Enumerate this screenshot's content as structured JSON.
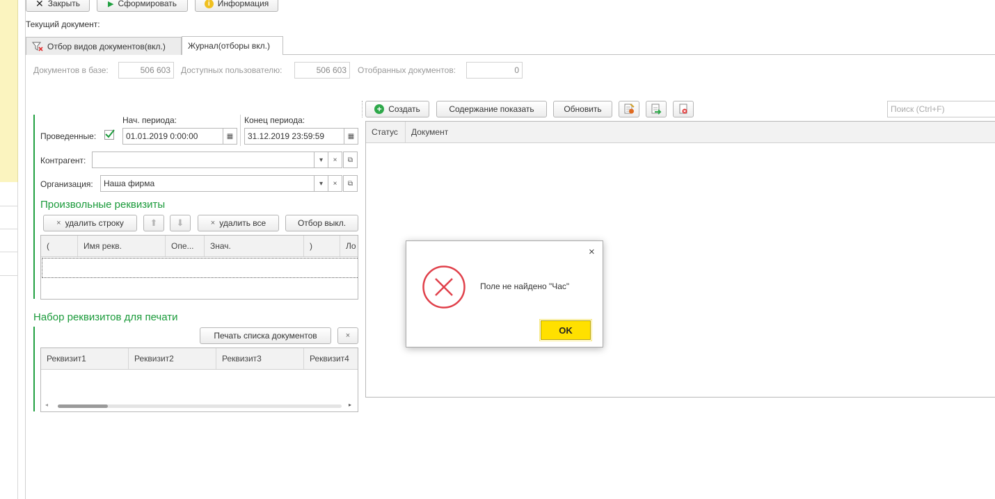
{
  "toolbar": {
    "close_label": "Закрыть",
    "generate_label": "Сформировать",
    "info_label": "Информация"
  },
  "current_document_label": "Текущий документ:",
  "tabs": [
    {
      "label": "Отбор видов документов(вкл.)",
      "icon": "filter-off-icon"
    },
    {
      "label": "Журнал(отборы вкл.)"
    }
  ],
  "stats": {
    "in_base_label": "Документов в базе:",
    "in_base_value": "506 603",
    "available_label": "Доступных пользователю:",
    "available_value": "506 603",
    "selected_label": "Отобранных документов:",
    "selected_value": "0"
  },
  "filters": {
    "period_start_label": "Нач. периода:",
    "period_end_label": "Конец периода:",
    "posted_label": "Проведенные:",
    "posted_checked": true,
    "period_start_value": "01.01.2019  0:00:00",
    "period_end_value": "31.12.2019 23:59:59",
    "counterparty_label": "Контрагент:",
    "counterparty_value": "",
    "organization_label": "Организация:",
    "organization_value": "Наша фирма"
  },
  "custom_attrs": {
    "title": "Произвольные  реквизиты",
    "delete_row_label": "удалить строку",
    "delete_all_label": "удалить все",
    "filter_off_label": "Отбор выкл.",
    "columns": [
      "(",
      "Имя рекв.",
      "Опе...",
      "Знач.",
      ")",
      "Ло"
    ]
  },
  "print_attrs": {
    "title": "Набор реквизитов для печати",
    "print_list_label": "Печать списка документов",
    "columns": [
      "Реквизит1",
      "Реквизит2",
      "Реквизит3",
      "Реквизит4"
    ]
  },
  "journal": {
    "create_label": "Создать",
    "show_content_label": "Содержание показать",
    "refresh_label": "Обновить",
    "search_placeholder": "Поиск (Ctrl+F)",
    "columns": [
      "Статус",
      "Документ"
    ]
  },
  "dialog": {
    "message": "Поле не найдено \"Час\"",
    "ok_label": "OK",
    "icon": "error-icon"
  },
  "colors": {
    "accent_green": "#1a9a3a",
    "ok_yellow": "#ffe000",
    "error_red": "#e0404a"
  }
}
